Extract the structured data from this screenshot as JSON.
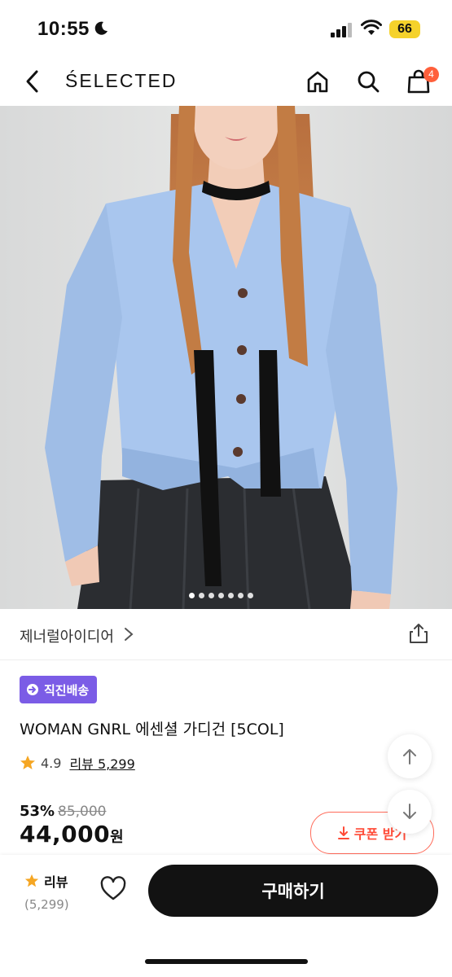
{
  "status_bar": {
    "time": "10:55",
    "battery": "66"
  },
  "nav": {
    "brand": "ŚELECTED",
    "cart_count": "4"
  },
  "hero": {
    "image_count": 7,
    "active_index": 0
  },
  "seller": {
    "name": "제너럴아이디어"
  },
  "product": {
    "badge": "직진배송",
    "title": "WOMAN GNRL 에센셜 가디건 [5COL]",
    "rating": "4.9",
    "review_label": "리뷰 5,299",
    "discount": "53%",
    "original_price": "85,000",
    "price": "44,000",
    "currency": "원"
  },
  "coupon": {
    "label": "쿠폰 받기"
  },
  "bottom": {
    "review_label": "리뷰",
    "review_count": "(5,299)",
    "buy_label": "구매하기"
  },
  "colors": {
    "accent": "#7b5ce6",
    "coupon": "#ff4a36",
    "badge": "#ff5f3b",
    "star": "#f5a623",
    "cardigan": "#a9c6ee"
  }
}
